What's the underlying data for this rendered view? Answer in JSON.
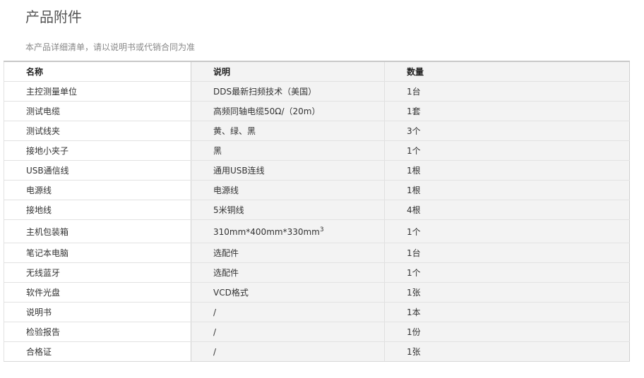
{
  "page": {
    "title": "产品附件",
    "subtitle": "本产品详细清单，请以说明书或代销合同为准"
  },
  "table": {
    "headers": [
      "名称",
      "说明",
      "数量"
    ],
    "rows": [
      {
        "name": "主控测量单位",
        "desc": "DDS最新扫频技术（美国）",
        "qty": "1台"
      },
      {
        "name": "测试电缆",
        "desc": "高频同轴电缆50Ω/（20m）",
        "qty": "1套"
      },
      {
        "name": "测试线夹",
        "desc": "黄、绿、黑",
        "qty": "3个"
      },
      {
        "name": "接地小夹子",
        "desc": "黑",
        "qty": "1个"
      },
      {
        "name": "USB通信线",
        "desc": "通用USB连线",
        "qty": "1根"
      },
      {
        "name": "电源线",
        "desc": "电源线",
        "qty": "1根"
      },
      {
        "name": "接地线",
        "desc": "5米铜线",
        "qty": "4根"
      },
      {
        "name": "主机包装箱",
        "desc": "310mm*400mm*330mm",
        "desc_sup": "3",
        "qty": "1个"
      },
      {
        "name": "笔记本电脑",
        "desc": "选配件",
        "qty": "1台"
      },
      {
        "name": "无线蓝牙",
        "desc": "选配件",
        "qty": "1个"
      },
      {
        "name": "软件光盘",
        "desc": "VCD格式",
        "qty": "1张"
      },
      {
        "name": "说明书",
        "desc": "/",
        "qty": "1本"
      },
      {
        "name": "检验报告",
        "desc": "/",
        "qty": "1份"
      },
      {
        "name": "合格证",
        "desc": "/",
        "qty": "1张"
      }
    ]
  }
}
